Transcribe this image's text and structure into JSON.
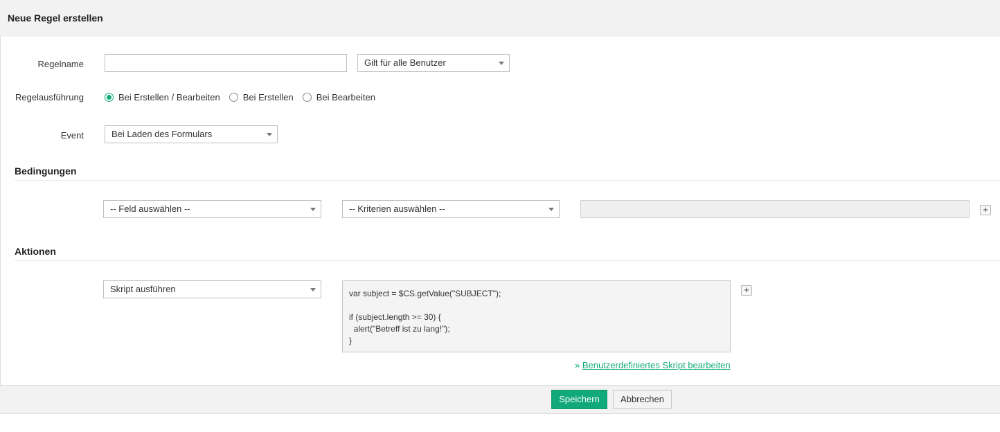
{
  "header": {
    "title": "Neue Regel erstellen"
  },
  "form": {
    "rule_name": {
      "label": "Regelname",
      "value": "",
      "placeholder": ""
    },
    "user_scope": {
      "value": "Gilt für alle Benutzer"
    },
    "execution": {
      "label": "Regelausführung",
      "options": [
        {
          "label": "Bei Erstellen / Bearbeiten",
          "checked": true
        },
        {
          "label": "Bei Erstellen",
          "checked": false
        },
        {
          "label": "Bei Bearbeiten",
          "checked": false
        }
      ]
    },
    "event": {
      "label": "Event",
      "value": "Bei Laden des Formulars"
    }
  },
  "conditions": {
    "title": "Bedingungen",
    "field_select": "-- Feld auswählen --",
    "criteria_select": "-- Kriterien auswählen --",
    "value": "",
    "add_label": "+"
  },
  "actions": {
    "title": "Aktionen",
    "action_select": "Skript ausführen",
    "add_label": "+",
    "script_lines": [
      "var subject = $CS.getValue(\"SUBJECT\");",
      "",
      "if (subject.length >= 30) {",
      "  alert(\"Betreff ist zu lang!\");",
      "}"
    ],
    "edit_link_prefix": "» ",
    "edit_link_label": "Benutzerdefiniertes Skript bearbeiten"
  },
  "footer": {
    "save_label": "Speichern",
    "cancel_label": "Abbrechen"
  },
  "colors": {
    "accent": "#12a97a",
    "header_bg": "#f2f2f2"
  }
}
